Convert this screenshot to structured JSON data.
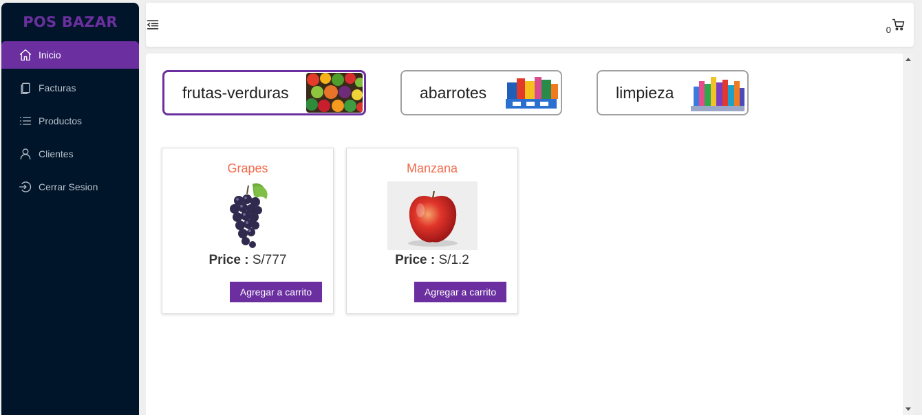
{
  "brand": "POS BAZAR",
  "sidebar": {
    "items": [
      {
        "label": "Inicio",
        "icon": "home-icon",
        "active": true
      },
      {
        "label": "Facturas",
        "icon": "documents-icon"
      },
      {
        "label": "Productos",
        "icon": "list-icon"
      },
      {
        "label": "Clientes",
        "icon": "user-icon"
      },
      {
        "label": "Cerrar Sesion",
        "icon": "logout-icon"
      }
    ]
  },
  "header": {
    "cart_count": "0"
  },
  "categories": [
    {
      "label": "frutas-verduras",
      "selected": true
    },
    {
      "label": "abarrotes"
    },
    {
      "label": "limpieza"
    }
  ],
  "products": [
    {
      "name": "Grapes",
      "price_label": "Price :",
      "price_value": "S/777",
      "button_label": "Agregar a carrito"
    },
    {
      "name": "Manzana",
      "price_label": "Price :",
      "price_value": "S/1.2",
      "button_label": "Agregar a carrito"
    }
  ],
  "colors": {
    "accent": "#6b2fa0",
    "sidebar_bg": "#001529",
    "product_name": "#f26a4b"
  }
}
